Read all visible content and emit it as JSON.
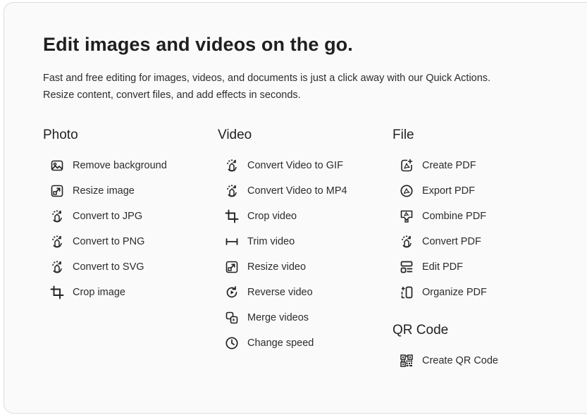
{
  "header": {
    "title": "Edit images and videos on the go.",
    "subtitle_line1": "Fast and free editing for images, videos, and documents is just a click away with our Quick Actions.",
    "subtitle_line2": "Resize content, convert files, and add effects in seconds."
  },
  "columns": {
    "photo": {
      "heading": "Photo",
      "items": [
        {
          "label": "Remove background",
          "icon": "image-icon"
        },
        {
          "label": "Resize image",
          "icon": "resize-icon"
        },
        {
          "label": "Convert to JPG",
          "icon": "convert-icon"
        },
        {
          "label": "Convert to PNG",
          "icon": "convert-icon"
        },
        {
          "label": "Convert to SVG",
          "icon": "convert-icon"
        },
        {
          "label": "Crop image",
          "icon": "crop-icon"
        }
      ]
    },
    "video": {
      "heading": "Video",
      "items": [
        {
          "label": "Convert Video to GIF",
          "icon": "convert-icon"
        },
        {
          "label": "Convert Video to MP4",
          "icon": "convert-icon"
        },
        {
          "label": "Crop video",
          "icon": "crop-icon"
        },
        {
          "label": "Trim video",
          "icon": "trim-icon"
        },
        {
          "label": "Resize video",
          "icon": "resize-icon"
        },
        {
          "label": "Reverse video",
          "icon": "reverse-icon"
        },
        {
          "label": "Merge videos",
          "icon": "merge-icon"
        },
        {
          "label": "Change speed",
          "icon": "clock-icon"
        }
      ]
    },
    "file": {
      "heading": "File",
      "items": [
        {
          "label": "Create PDF",
          "icon": "create-pdf-icon"
        },
        {
          "label": "Export PDF",
          "icon": "export-pdf-icon"
        },
        {
          "label": "Combine PDF",
          "icon": "combine-pdf-icon"
        },
        {
          "label": "Convert PDF",
          "icon": "convert-icon"
        },
        {
          "label": "Edit PDF",
          "icon": "edit-pdf-icon"
        },
        {
          "label": "Organize PDF",
          "icon": "organize-pdf-icon"
        }
      ]
    },
    "qr": {
      "heading": "QR Code",
      "items": [
        {
          "label": "Create QR Code",
          "icon": "qr-code-icon"
        }
      ]
    }
  },
  "colors": {
    "card_background": "#fafafa",
    "card_border": "#dcdcdc",
    "text": "#2c2c2c",
    "icon": "#222222"
  }
}
